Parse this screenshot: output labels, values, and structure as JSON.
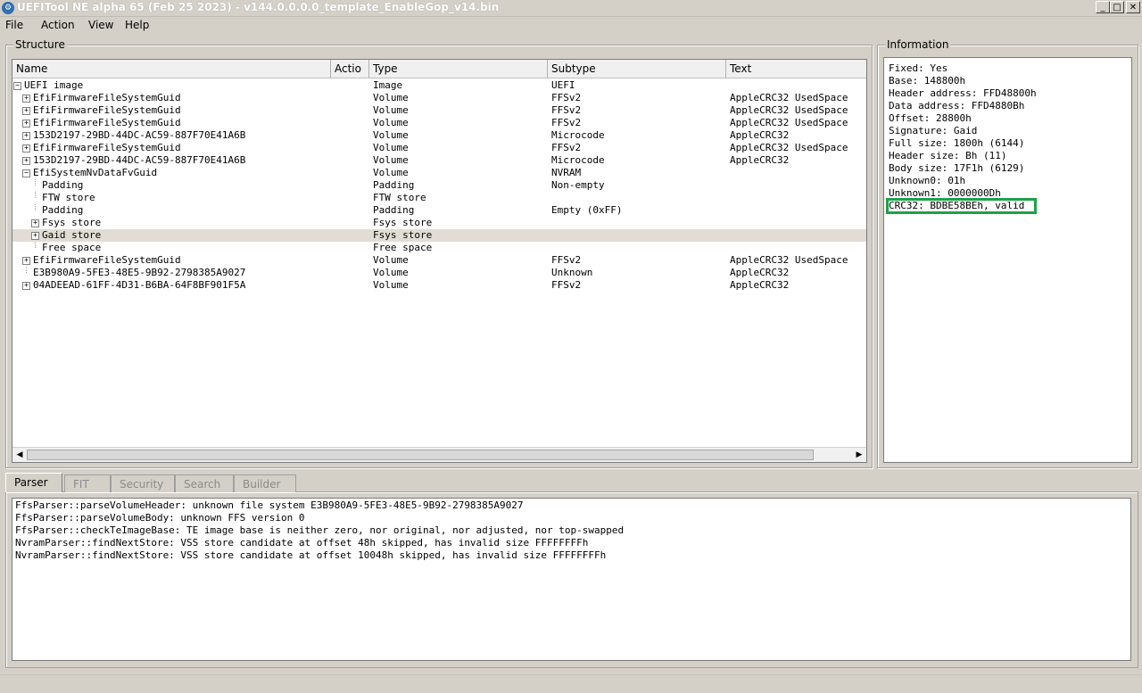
{
  "window": {
    "title": "UEFITool NE alpha 65 (Feb 25 2023) - v144.0.0.0.0_template_EnableGop_v14.bin",
    "min": "_",
    "max": "□",
    "close": "✕"
  },
  "menu": [
    "File",
    "Action",
    "View",
    "Help"
  ],
  "structure": {
    "title": "Structure",
    "columns": [
      "Name",
      "Actio",
      "Type",
      "Subtype",
      "Text"
    ],
    "rows": [
      {
        "name": "UEFI image",
        "action": "",
        "type": "Image",
        "subtype": "UEFI",
        "text": "",
        "level": 0,
        "expander": "minus"
      },
      {
        "name": "EfiFirmwareFileSystemGuid",
        "action": "",
        "type": "Volume",
        "subtype": "FFSv2",
        "text": "AppleCRC32 UsedSpace",
        "level": 1,
        "expander": "plus"
      },
      {
        "name": "EfiFirmwareFileSystemGuid",
        "action": "",
        "type": "Volume",
        "subtype": "FFSv2",
        "text": "AppleCRC32 UsedSpace",
        "level": 1,
        "expander": "plus"
      },
      {
        "name": "EfiFirmwareFileSystemGuid",
        "action": "",
        "type": "Volume",
        "subtype": "FFSv2",
        "text": "AppleCRC32 UsedSpace",
        "level": 1,
        "expander": "plus"
      },
      {
        "name": "153D2197-29BD-44DC-AC59-887F70E41A6B",
        "action": "",
        "type": "Volume",
        "subtype": "Microcode",
        "text": "AppleCRC32",
        "level": 1,
        "expander": "plus"
      },
      {
        "name": "EfiFirmwareFileSystemGuid",
        "action": "",
        "type": "Volume",
        "subtype": "FFSv2",
        "text": "AppleCRC32 UsedSpace",
        "level": 1,
        "expander": "plus"
      },
      {
        "name": "153D2197-29BD-44DC-AC59-887F70E41A6B",
        "action": "",
        "type": "Volume",
        "subtype": "Microcode",
        "text": "AppleCRC32",
        "level": 1,
        "expander": "plus"
      },
      {
        "name": "EfiSystemNvDataFvGuid",
        "action": "",
        "type": "Volume",
        "subtype": "NVRAM",
        "text": "",
        "level": 1,
        "expander": "minus"
      },
      {
        "name": "Padding",
        "action": "",
        "type": "Padding",
        "subtype": "Non-empty",
        "text": "",
        "level": 2,
        "expander": "none"
      },
      {
        "name": "FTW store",
        "action": "",
        "type": "FTW store",
        "subtype": "",
        "text": "",
        "level": 2,
        "expander": "none"
      },
      {
        "name": "Padding",
        "action": "",
        "type": "Padding",
        "subtype": "Empty (0xFF)",
        "text": "",
        "level": 2,
        "expander": "none"
      },
      {
        "name": "Fsys store",
        "action": "",
        "type": "Fsys store",
        "subtype": "",
        "text": "",
        "level": 2,
        "expander": "plus"
      },
      {
        "name": "Gaid store",
        "action": "",
        "type": "Fsys store",
        "subtype": "",
        "text": "",
        "level": 2,
        "expander": "plus",
        "selected": true
      },
      {
        "name": "Free space",
        "action": "",
        "type": "Free space",
        "subtype": "",
        "text": "",
        "level": 2,
        "expander": "none"
      },
      {
        "name": "EfiFirmwareFileSystemGuid",
        "action": "",
        "type": "Volume",
        "subtype": "FFSv2",
        "text": "AppleCRC32 UsedSpace",
        "level": 1,
        "expander": "plus"
      },
      {
        "name": "E3B980A9-5FE3-48E5-9B92-2798385A9027",
        "action": "",
        "type": "Volume",
        "subtype": "Unknown",
        "text": "AppleCRC32",
        "level": 1,
        "expander": "none"
      },
      {
        "name": "04ADEEAD-61FF-4D31-B6BA-64F8BF901F5A",
        "action": "",
        "type": "Volume",
        "subtype": "FFSv2",
        "text": "AppleCRC32",
        "level": 1,
        "expander": "plus"
      }
    ]
  },
  "information": {
    "title": "Information",
    "lines": [
      "Fixed: Yes",
      "Base: 148800h",
      "Header address: FFD48800h",
      "Data address: FFD4880Bh",
      "Offset: 28800h",
      "Signature: Gaid",
      "Full size: 1800h (6144)",
      "Header size: Bh (11)",
      "Body size: 17F1h (6129)",
      "Unknown0: 01h",
      "Unknown1: 0000000Dh",
      "CRC32: BDBE58BEh, valid"
    ],
    "highlight_color": "#1fa04a"
  },
  "tabs": [
    "Parser",
    "FIT",
    "Security",
    "Search",
    "Builder"
  ],
  "active_tab": "Parser",
  "log": [
    "FfsParser::parseVolumeHeader: unknown file system E3B980A9-5FE3-48E5-9B92-2798385A9027",
    "FfsParser::parseVolumeBody: unknown FFS version 0",
    "FfsParser::checkTeImageBase: TE image base is neither zero, nor original, nor adjusted, nor top-swapped",
    "NvramParser::findNextStore: VSS store candidate at offset 48h skipped, has invalid size FFFFFFFFh",
    "NvramParser::findNextStore: VSS store candidate at offset 10048h skipped, has invalid size FFFFFFFFh"
  ]
}
